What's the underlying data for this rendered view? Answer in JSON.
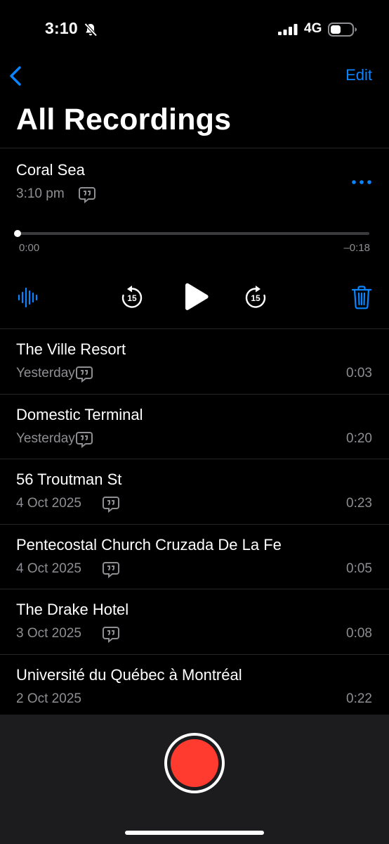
{
  "status_bar": {
    "time": "3:10",
    "network": "4G"
  },
  "nav": {
    "edit_label": "Edit",
    "title": "All Recordings"
  },
  "expanded": {
    "title": "Coral Sea",
    "time": "3:10 pm",
    "elapsed": "0:00",
    "remaining": "–0:18",
    "progress": 0,
    "skip_seconds": "15"
  },
  "recordings": [
    {
      "title": "The Ville Resort",
      "date": "Yesterday",
      "duration": "0:03"
    },
    {
      "title": "Domestic Terminal",
      "date": "Yesterday",
      "duration": "0:20"
    },
    {
      "title": "56 Troutman St",
      "date": "4 Oct 2025",
      "duration": "0:23"
    },
    {
      "title": "Pentecostal Church Cruzada De La Fe",
      "date": "4 Oct 2025",
      "duration": "0:05"
    },
    {
      "title": "The Drake Hotel",
      "date": "3 Oct 2025",
      "duration": "0:08"
    },
    {
      "title": "Université du Québec à Montréal",
      "date": "2 Oct 2025",
      "duration": "0:22"
    }
  ],
  "colors": {
    "accent": "#0a84ff",
    "record": "#ff3b30",
    "secondary_text": "#8e8e93",
    "background": "#000000",
    "toolbar": "#1c1c1e"
  },
  "icons": [
    "bell-slash-icon",
    "signal-icon",
    "battery-icon",
    "chevron-left-icon",
    "more-icon",
    "transcript-icon",
    "waveform-icon",
    "skip-back-15-icon",
    "play-icon",
    "skip-forward-15-icon",
    "trash-icon",
    "record-icon"
  ]
}
